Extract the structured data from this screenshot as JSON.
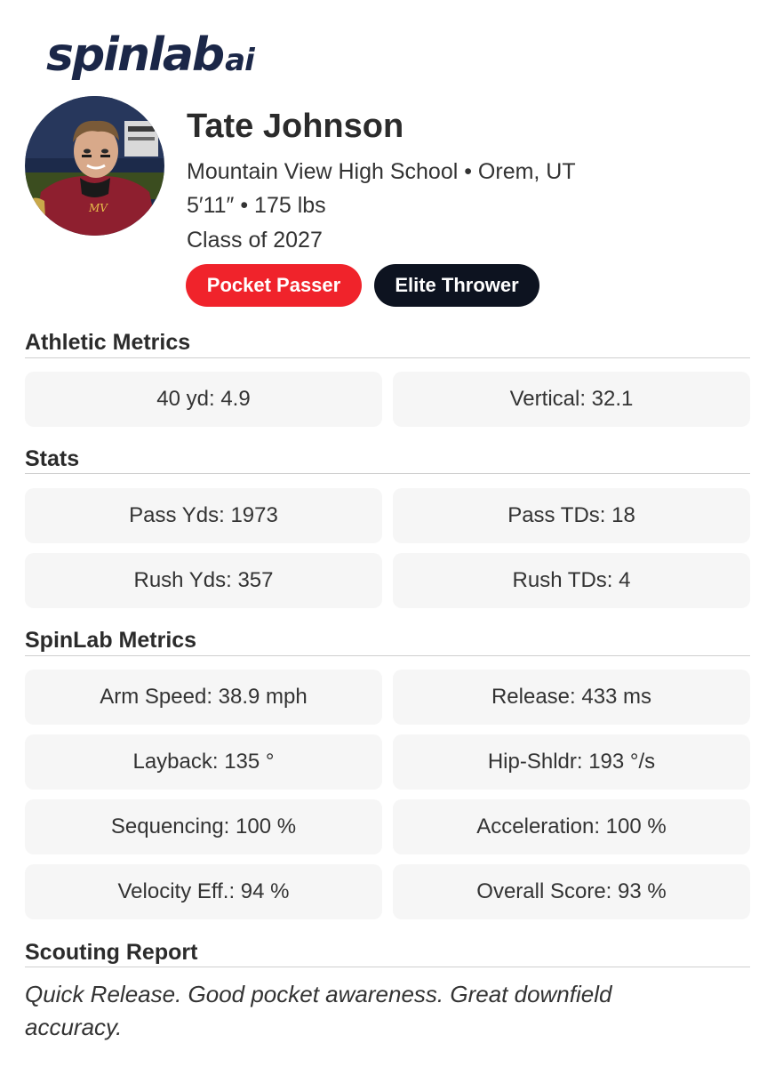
{
  "brand": {
    "logo_main": "spinlab",
    "logo_ai": "ai",
    "color": "#1b2748"
  },
  "player": {
    "name": "Tate Johnson",
    "school_line": "Mountain View High School • Orem, UT",
    "size_line": "5′11″ • 175 lbs",
    "class_line": "Class of 2027",
    "photo_icon": "player-photo"
  },
  "tags": [
    {
      "label": "Pocket Passer",
      "color": "#f0232b"
    },
    {
      "label": "Elite Thrower",
      "color": "#0d1320"
    }
  ],
  "athletic": {
    "title": "Athletic Metrics",
    "items": [
      "40 yd: 4.9",
      "Vertical: 32.1"
    ]
  },
  "stats": {
    "title": "Stats",
    "items": [
      "Pass Yds: 1973",
      "Pass TDs: 18",
      "Rush Yds: 357",
      "Rush TDs: 4"
    ]
  },
  "spinlab": {
    "title": "SpinLab Metrics",
    "items": [
      "Arm Speed: 38.9 mph",
      "Release: 433 ms",
      "Layback: 135 °",
      "Hip-Shldr: 193 °/s",
      "Sequencing: 100  %",
      "Acceleration: 100 %",
      "Velocity Eff.: 94 %",
      "Overall Score: 93 %"
    ]
  },
  "scouting": {
    "title": "Scouting Report",
    "text": "Quick Release. Good pocket awareness. Great downfield accuracy."
  }
}
